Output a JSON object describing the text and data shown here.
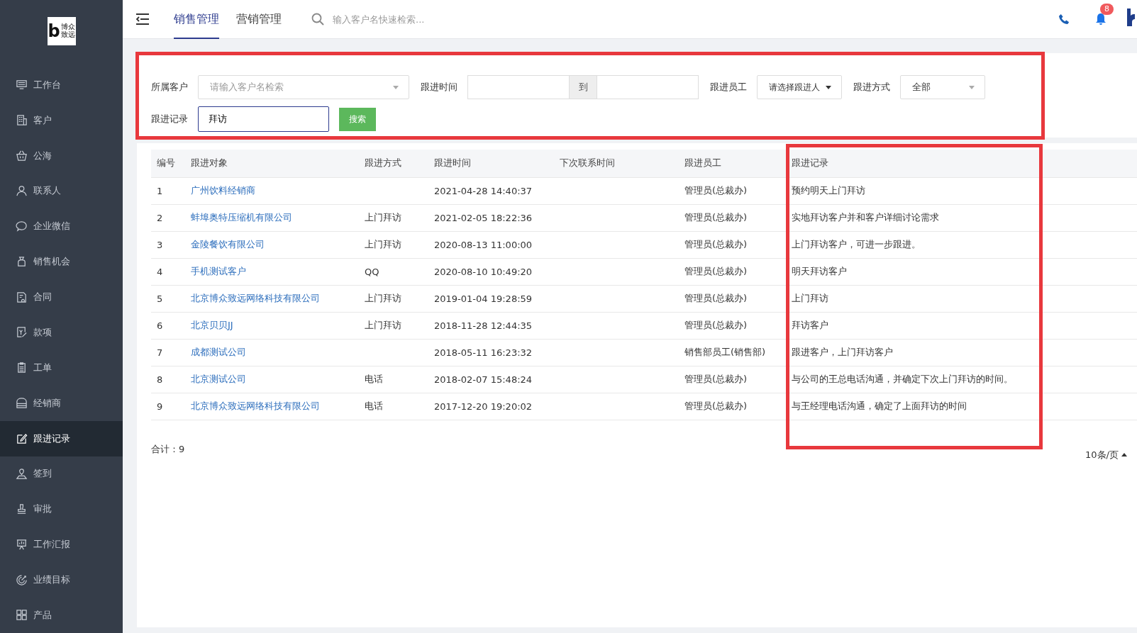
{
  "sidebar": {
    "logo_mark": "b",
    "logo_text": "博众致远",
    "items": [
      {
        "label": "工作台",
        "selected": false
      },
      {
        "label": "客户",
        "selected": false
      },
      {
        "label": "公海",
        "selected": false
      },
      {
        "label": "联系人",
        "selected": false
      },
      {
        "label": "企业微信",
        "selected": false
      },
      {
        "label": "销售机会",
        "selected": false
      },
      {
        "label": "合同",
        "selected": false
      },
      {
        "label": "款项",
        "selected": false
      },
      {
        "label": "工单",
        "selected": false
      },
      {
        "label": "经销商",
        "selected": false
      },
      {
        "label": "跟进记录",
        "selected": true
      },
      {
        "label": "签到",
        "selected": false
      },
      {
        "label": "审批",
        "selected": false
      },
      {
        "label": "工作汇报",
        "selected": false
      },
      {
        "label": "业绩目标",
        "selected": false
      },
      {
        "label": "产品",
        "selected": false
      }
    ]
  },
  "header": {
    "tabs": [
      {
        "label": "销售管理",
        "selected": true
      },
      {
        "label": "营销管理",
        "selected": false
      }
    ],
    "search": {
      "placeholder": "输入客户名快速检索..."
    },
    "notification_count": "8"
  },
  "filters": {
    "customer": {
      "label": "所属客户",
      "placeholder": "请输入客户名检索"
    },
    "time": {
      "label": "跟进时间",
      "separator": "到"
    },
    "employee": {
      "label": "跟进员工",
      "value": "请选择跟进人"
    },
    "method": {
      "label": "跟进方式",
      "value": "全部"
    },
    "record": {
      "label": "跟进记录",
      "value": "拜访"
    },
    "search_button": "搜索"
  },
  "table": {
    "columns": [
      "编号",
      "跟进对象",
      "跟进方式",
      "跟进时间",
      "下次联系时间",
      "跟进员工",
      "跟进记录"
    ],
    "rows": [
      [
        "1",
        "广州饮料经销商",
        "",
        "2021-04-28 14:40:37",
        "",
        "管理员(总裁办)",
        "预约明天上门拜访"
      ],
      [
        "2",
        "蚌埠奥特压缩机有限公司",
        "上门拜访",
        "2021-02-05 18:22:36",
        "",
        "管理员(总裁办)",
        "实地拜访客户并和客户详细讨论需求"
      ],
      [
        "3",
        "金陵餐饮有限公司",
        "上门拜访",
        "2020-08-13 11:00:00",
        "",
        "管理员(总裁办)",
        "上门拜访客户，可进一步跟进。"
      ],
      [
        "4",
        "手机测试客户",
        "QQ",
        "2020-08-10 10:49:20",
        "",
        "管理员(总裁办)",
        "明天拜访客户"
      ],
      [
        "5",
        "北京博众致远网络科技有限公司",
        "上门拜访",
        "2019-01-04 19:28:59",
        "",
        "管理员(总裁办)",
        "上门拜访"
      ],
      [
        "6",
        "北京贝贝JJ",
        "上门拜访",
        "2018-11-28 12:44:35",
        "",
        "管理员(总裁办)",
        "拜访客户"
      ],
      [
        "7",
        "成都测试公司",
        "",
        "2018-05-11 16:23:32",
        "",
        "销售部员工(销售部)",
        "跟进客户，上门拜访客户"
      ],
      [
        "8",
        "北京测试公司",
        "电话",
        "2018-02-07 15:48:24",
        "",
        "管理员(总裁办)",
        "与公司的王总电话沟通，并确定下次上门拜访的时间。"
      ],
      [
        "9",
        "北京博众致远网络科技有限公司",
        "电话",
        "2017-12-20 19:20:02",
        "",
        "管理员(总裁办)",
        "与王经理电话沟通，确定了上面拜访的时间"
      ]
    ]
  },
  "footer": {
    "total": "合计：9",
    "page_size": "10条/页"
  }
}
